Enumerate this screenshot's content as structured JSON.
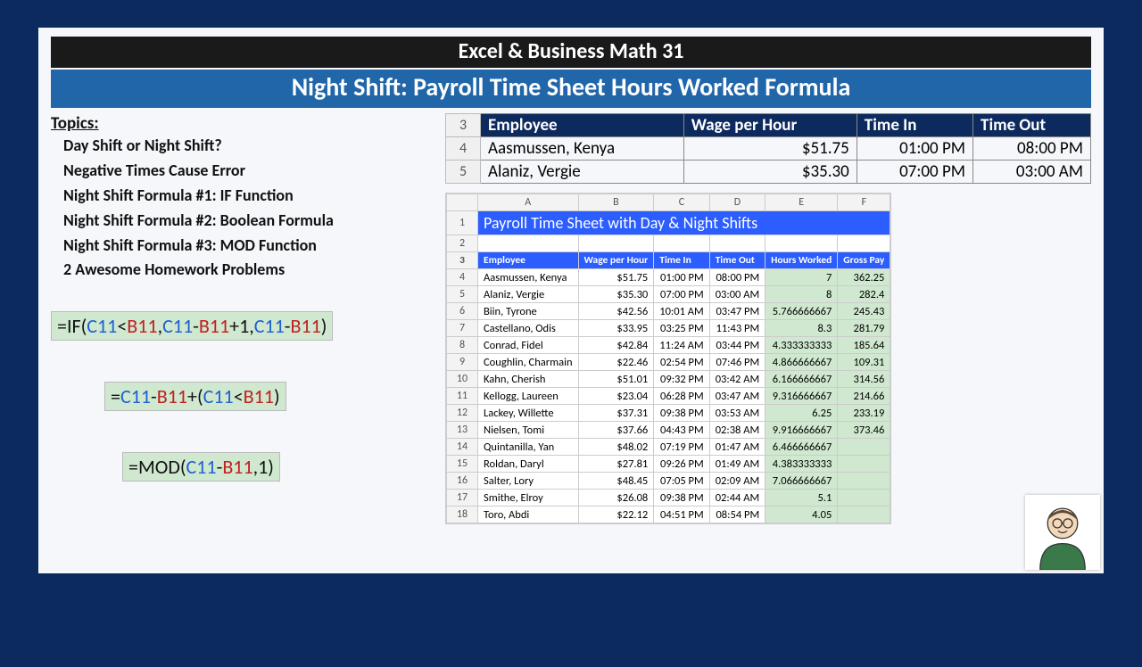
{
  "header": {
    "line1": "Excel & Business Math 31",
    "line2": "Night Shift: Payroll Time Sheet Hours Worked Formula"
  },
  "topics": {
    "title": "Topics:",
    "items": [
      "Day Shift or Night Shift?",
      "Negative Times Cause Error",
      "Night Shift Formula #1: IF Function",
      "Night Shift Formula #2: Boolean Formula",
      "Night Shift Formula #3: MOD Function",
      "2 Awesome Homework Problems"
    ]
  },
  "upper_table": {
    "headers": [
      "Employee",
      "Wage per Hour",
      "Time In",
      "Time Out"
    ],
    "row_nums": [
      "3",
      "4",
      "5"
    ],
    "rows": [
      [
        "Aasmussen, Kenya",
        "$51.75",
        "01:00 PM",
        "08:00 PM"
      ],
      [
        "Alaniz, Vergie",
        "$35.30",
        "07:00 PM",
        "03:00 AM"
      ]
    ]
  },
  "sheet": {
    "title": "Payroll Time Sheet with Day & Night Shifts",
    "cols": [
      "A",
      "B",
      "C",
      "D",
      "E",
      "F"
    ],
    "headers": [
      "Employee",
      "Wage per Hour",
      "Time In",
      "Time Out",
      "Hours Worked",
      "Gross Pay"
    ],
    "rows": [
      {
        "n": "4",
        "employee": "Aasmussen, Kenya",
        "wage": "$51.75",
        "in": "01:00 PM",
        "out": "08:00 PM",
        "hours": "7",
        "gross": "362.25"
      },
      {
        "n": "5",
        "employee": "Alaniz, Vergie",
        "wage": "$35.30",
        "in": "07:00 PM",
        "out": "03:00 AM",
        "hours": "8",
        "gross": "282.4"
      },
      {
        "n": "6",
        "employee": "Biin, Tyrone",
        "wage": "$42.56",
        "in": "10:01 AM",
        "out": "03:47 PM",
        "hours": "5.766666667",
        "gross": "245.43"
      },
      {
        "n": "7",
        "employee": "Castellano, Odis",
        "wage": "$33.95",
        "in": "03:25 PM",
        "out": "11:43 PM",
        "hours": "8.3",
        "gross": "281.79"
      },
      {
        "n": "8",
        "employee": "Conrad, Fidel",
        "wage": "$42.84",
        "in": "11:24 AM",
        "out": "03:44 PM",
        "hours": "4.333333333",
        "gross": "185.64"
      },
      {
        "n": "9",
        "employee": "Coughlin, Charmain",
        "wage": "$22.46",
        "in": "02:54 PM",
        "out": "07:46 PM",
        "hours": "4.866666667",
        "gross": "109.31"
      },
      {
        "n": "10",
        "employee": "Kahn, Cherish",
        "wage": "$51.01",
        "in": "09:32 PM",
        "out": "03:42 AM",
        "hours": "6.166666667",
        "gross": "314.56"
      },
      {
        "n": "11",
        "employee": "Kellogg, Laureen",
        "wage": "$23.04",
        "in": "06:28 PM",
        "out": "03:47 AM",
        "hours": "9.316666667",
        "gross": "214.66"
      },
      {
        "n": "12",
        "employee": "Lackey, Willette",
        "wage": "$37.31",
        "in": "09:38 PM",
        "out": "03:53 AM",
        "hours": "6.25",
        "gross": "233.19"
      },
      {
        "n": "13",
        "employee": "Nielsen, Tomi",
        "wage": "$37.66",
        "in": "04:43 PM",
        "out": "02:38 AM",
        "hours": "9.916666667",
        "gross": "373.46"
      },
      {
        "n": "14",
        "employee": "Quintanilla, Yan",
        "wage": "$48.02",
        "in": "07:19 PM",
        "out": "01:47 AM",
        "hours": "6.466666667",
        "gross": ""
      },
      {
        "n": "15",
        "employee": "Roldan, Daryl",
        "wage": "$27.81",
        "in": "09:26 PM",
        "out": "01:49 AM",
        "hours": "4.383333333",
        "gross": ""
      },
      {
        "n": "16",
        "employee": "Salter, Lory",
        "wage": "$48.45",
        "in": "07:05 PM",
        "out": "02:09 AM",
        "hours": "7.066666667",
        "gross": ""
      },
      {
        "n": "17",
        "employee": "Smithe, Elroy",
        "wage": "$26.08",
        "in": "09:38 PM",
        "out": "02:44 AM",
        "hours": "5.1",
        "gross": ""
      },
      {
        "n": "18",
        "employee": "Toro, Abdi",
        "wage": "$22.12",
        "in": "04:51 PM",
        "out": "08:54 PM",
        "hours": "4.05",
        "gross": ""
      }
    ]
  },
  "formulas": {
    "f1_parts": [
      "=IF(",
      "C11",
      "<",
      "B11",
      ",",
      "C11",
      "-",
      "B11",
      "+1,",
      "C11",
      "-",
      "B11",
      ")"
    ],
    "f2_parts": [
      "=",
      "C11",
      "-",
      "B11",
      "+(",
      "C11",
      "<",
      "B11",
      ")"
    ],
    "f3_parts": [
      "=MOD(",
      "C11",
      "-",
      "B11",
      ",1)"
    ]
  }
}
